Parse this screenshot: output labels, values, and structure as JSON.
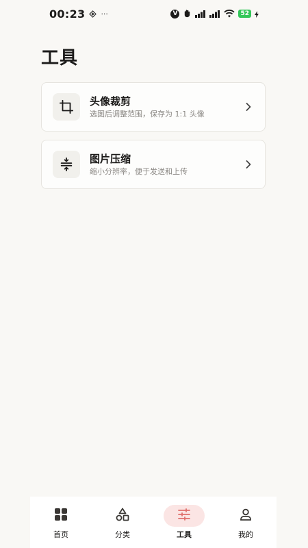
{
  "status_bar": {
    "time": "00:23",
    "more": "···",
    "battery": "52"
  },
  "page": {
    "title": "工具"
  },
  "tools": [
    {
      "title": "头像裁剪",
      "desc": "选图后调整范围，保存为 1:1 头像",
      "icon": "crop-icon"
    },
    {
      "title": "图片压缩",
      "desc": "缩小分辨率，便于发送和上传",
      "icon": "compress-icon"
    }
  ],
  "nav": {
    "items": [
      {
        "label": "首页",
        "icon": "grid-icon",
        "active": false
      },
      {
        "label": "分类",
        "icon": "shapes-icon",
        "active": false
      },
      {
        "label": "工具",
        "icon": "sliders-icon",
        "active": true
      },
      {
        "label": "我的",
        "icon": "user-icon",
        "active": false
      }
    ]
  },
  "colors": {
    "background": "#f9f8f5",
    "active_tab_pill": "#fbe5e4",
    "active_icon": "#e0706c",
    "battery": "#34c759"
  }
}
